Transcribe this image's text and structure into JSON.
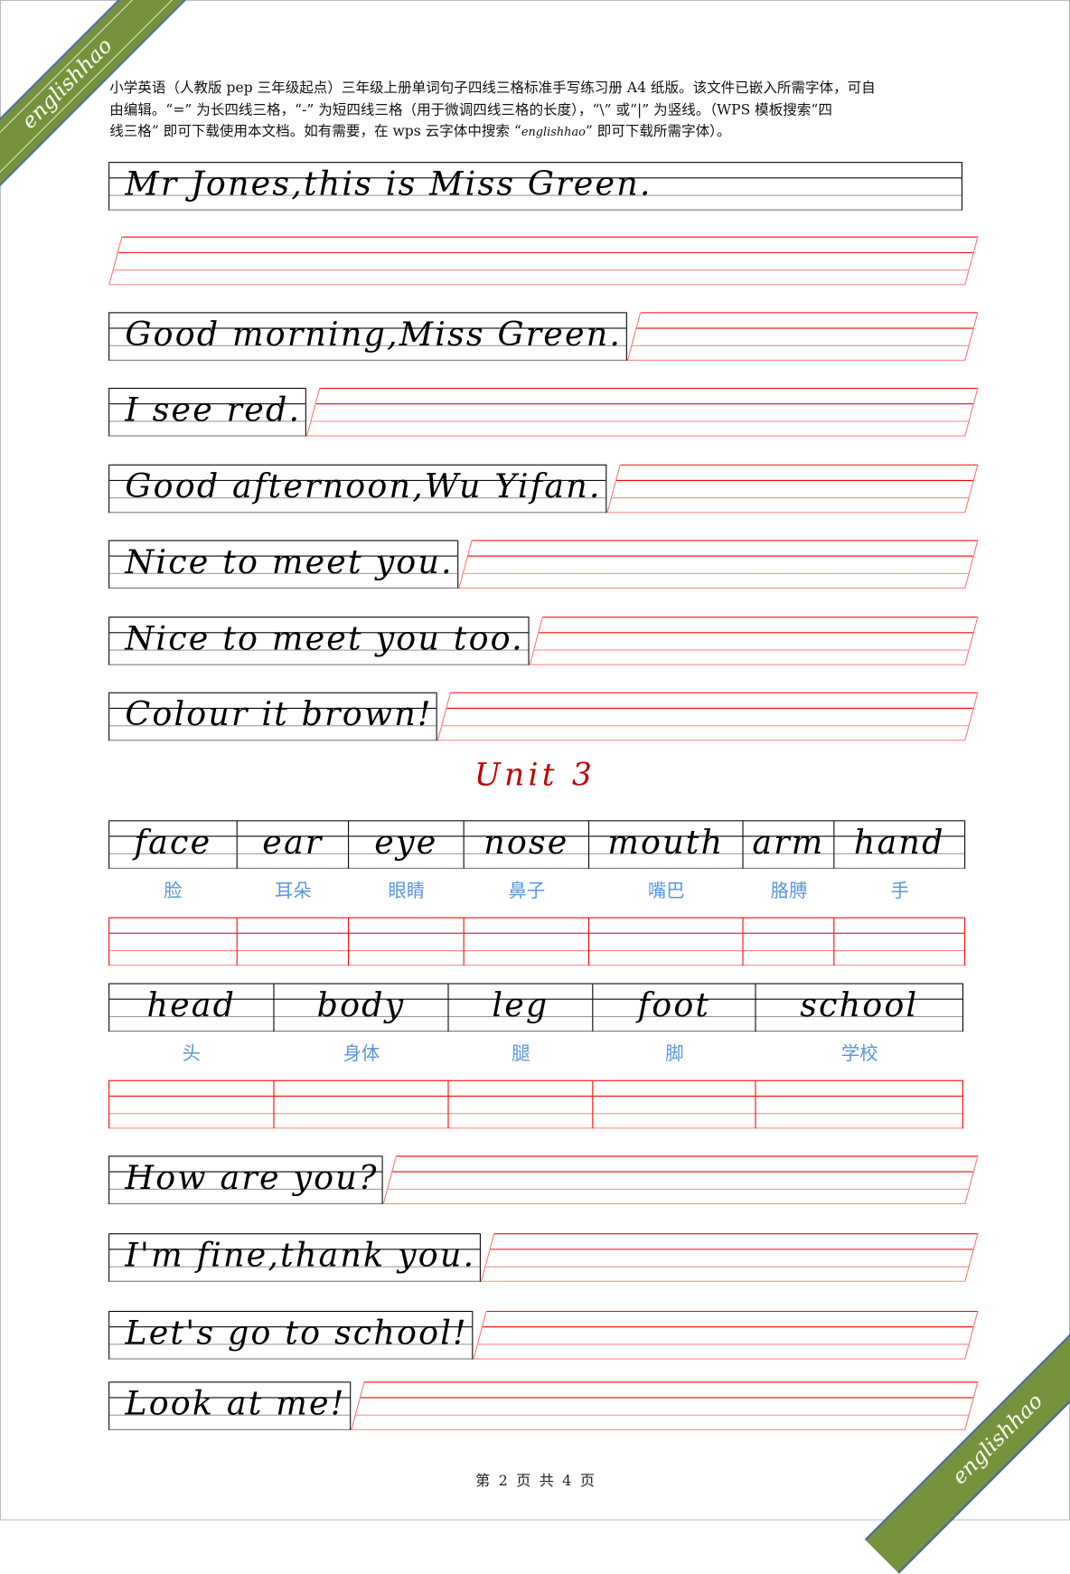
{
  "watermark": "englishhao",
  "intro": {
    "line1": "小学英语（人教版 pep 三年级起点）三年级上册单词句子四线三格标准手写练习册 A4 纸版。该文件已嵌入所需字体，可自",
    "line2": "由编辑。“=” 为长四线三格，“-” 为短四线三格（用于微调四线三格的长度），“\\” 或“|” 为竖线。（WPS 模板搜索“四",
    "line3a": "线三格” 即可下载使用本文档。如有需要，在 wps 云字体中搜索 “",
    "line3brand": "englishhao",
    "line3b": "” 即可下载所需字体）。"
  },
  "sentences_top": [
    "Mr Jones,this is Miss Green.",
    "Good morning,Miss Green.",
    "I see red.",
    "Good afternoon,Wu Yifan.",
    "Nice to meet you.",
    "Nice to meet you too.",
    "Colour it brown!"
  ],
  "unit_title": "Unit 3",
  "words1": [
    {
      "en": "face",
      "cn": "脸"
    },
    {
      "en": "ear",
      "cn": "耳朵"
    },
    {
      "en": "eye",
      "cn": "眼睛"
    },
    {
      "en": "nose",
      "cn": "鼻子"
    },
    {
      "en": "mouth",
      "cn": "嘴巴"
    },
    {
      "en": "arm",
      "cn": "胳膊"
    },
    {
      "en": "hand",
      "cn": "手"
    }
  ],
  "words2": [
    {
      "en": "head",
      "cn": "头"
    },
    {
      "en": "body",
      "cn": "身体"
    },
    {
      "en": "leg",
      "cn": "腿"
    },
    {
      "en": "foot",
      "cn": "脚"
    },
    {
      "en": "school",
      "cn": "学校"
    }
  ],
  "sentences_bottom": [
    "How are you?",
    "I'm fine,thank you.",
    "Let's go to school!",
    "Look at me!"
  ],
  "footer": "第 2 页 共 4 页",
  "colors": {
    "grid_red": "#ff0000",
    "word_blue": "#5b95e0",
    "unit_red": "#c00000",
    "banner_green": "#76923c"
  }
}
